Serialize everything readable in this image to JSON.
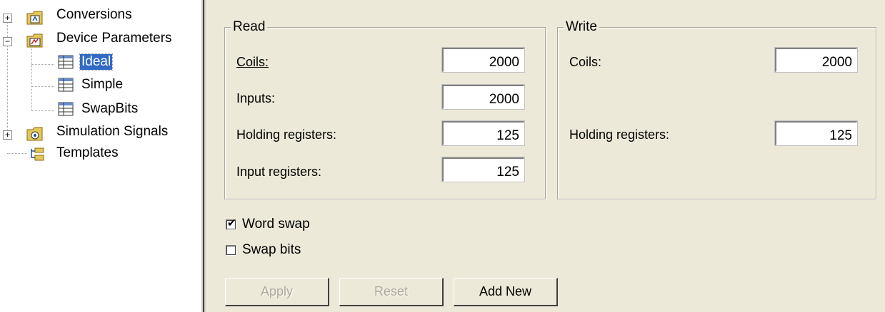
{
  "tree": {
    "items": [
      {
        "label": "Conversions",
        "expander": "+",
        "icon": "folder-conversions-icon"
      },
      {
        "label": "Device Parameters",
        "expander": "−",
        "icon": "folder-device-icon"
      },
      {
        "label": "Ideal",
        "icon": "device-table-icon",
        "selected": true
      },
      {
        "label": "Simple",
        "icon": "device-table-icon"
      },
      {
        "label": "SwapBits",
        "icon": "device-table-icon"
      },
      {
        "label": "Simulation Signals",
        "expander": "+",
        "icon": "folder-simulation-icon"
      },
      {
        "label": "Templates",
        "icon": "templates-icon"
      }
    ]
  },
  "read": {
    "title": "Read",
    "coils_label": "Coils:",
    "coils_value": "2000",
    "inputs_label": "Inputs:",
    "inputs_value": "2000",
    "holding_label": "Holding registers:",
    "holding_value": "125",
    "input_regs_label": "Input registers:",
    "input_regs_value": "125"
  },
  "write": {
    "title": "Write",
    "coils_label": "Coils:",
    "coils_value": "2000",
    "holding_label": "Holding registers:",
    "holding_value": "125"
  },
  "options": {
    "word_swap_label": "Word swap",
    "word_swap_checked": true,
    "swap_bits_label": "Swap bits",
    "swap_bits_checked": false
  },
  "buttons": {
    "apply": "Apply",
    "reset": "Reset",
    "add_new": "Add New"
  },
  "colors": {
    "panel_bg": "#ece9d8",
    "selection": "#316ac5"
  }
}
